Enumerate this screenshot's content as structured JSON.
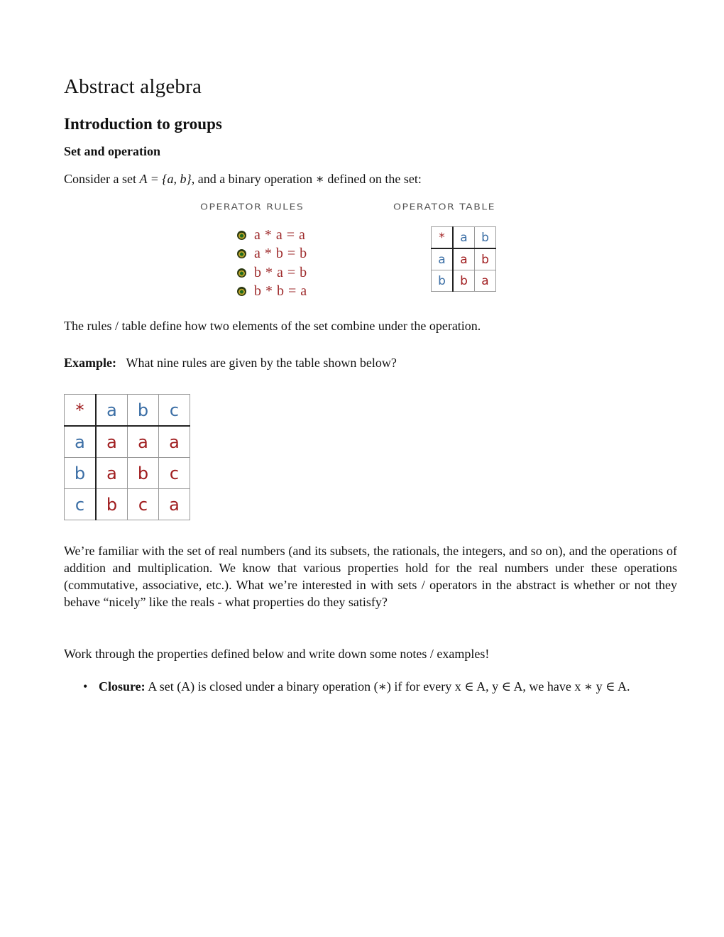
{
  "document": {
    "title": "Abstract algebra",
    "section": "Introduction to groups",
    "subsection": "Set and operation",
    "intro": {
      "prefix": "Consider a set ",
      "math": "A = {a, b}",
      "suffix": ", and a binary operation ∗ defined on the set:"
    },
    "figure": {
      "rules_title": "Operator rules",
      "table_title": "Operator table",
      "bullet_icon": "ball-bullet-icon",
      "rules": [
        "a * a = a",
        "a * b = b",
        "b * a = b",
        "b * b = a"
      ],
      "table": {
        "header": [
          "*",
          "a",
          "b"
        ],
        "rows": [
          [
            "a",
            "a",
            "b"
          ],
          [
            "b",
            "b",
            "a"
          ]
        ]
      }
    },
    "rules_note": "The rules / table define how two elements of the set combine under the operation.",
    "example": {
      "label": "Example:",
      "text": "What nine rules are given by the table shown below?",
      "table": {
        "header": [
          "*",
          "a",
          "b",
          "c"
        ],
        "rows": [
          [
            "a",
            "a",
            "a",
            "a"
          ],
          [
            "b",
            "a",
            "b",
            "c"
          ],
          [
            "c",
            "b",
            "c",
            "a"
          ]
        ]
      }
    },
    "paragraph": "We’re familiar with the set of real numbers (and its subsets, the rationals, the integers, and so on), and the operations of addition and multiplication. We know that various properties hold for the real numbers under these operations (commutative, associative, etc.). What we’re interested in with sets / operators in the abstract is whether or not they behave “nicely” like the reals - what properties do they satisfy?",
    "instruction": "Work through the properties defined below and write down some notes / examples!",
    "properties": [
      {
        "name": "Closure:",
        "text": "A set (A) is closed under a binary operation (∗) if for every x ∈ A, y ∈ A, we have x ∗ y ∈ A."
      }
    ]
  },
  "colors": {
    "header_blue": "#3b6ea5",
    "result_red": "#a01d1f",
    "rule_red": "#9e2a2b"
  }
}
